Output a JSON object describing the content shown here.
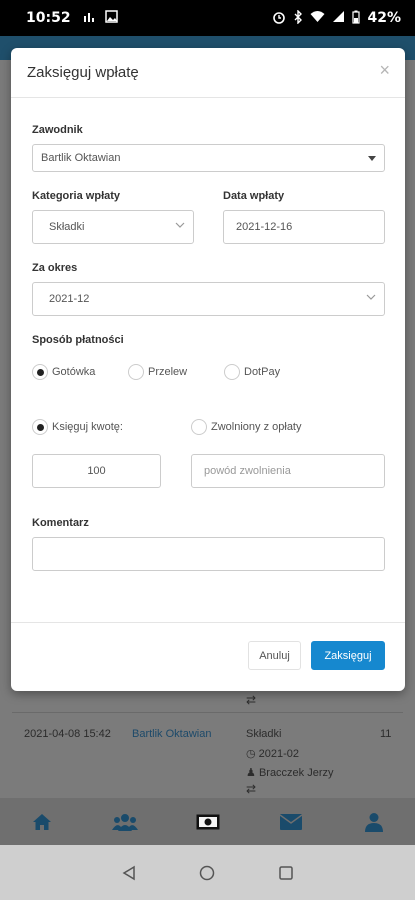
{
  "status_bar": {
    "time": "10:52",
    "battery": "42%",
    "left_icons": [
      "signal-boost-icon",
      "image-icon"
    ],
    "right_icons": [
      "alarm-icon",
      "bluetooth-icon",
      "wifi-icon",
      "cell-signal-icon",
      "battery-icon"
    ]
  },
  "modal": {
    "title": "Zaksięguj wpłatę",
    "close_glyph": "×",
    "player_label": "Zawodnik",
    "player_value": "Bartlik Oktawian",
    "category_label": "Kategoria wpłaty",
    "category_value": "Składki",
    "date_label": "Data wpłaty",
    "date_value": "2021-12-16",
    "period_label": "Za okres",
    "period_value": "2021-12",
    "method_label": "Sposób płatności",
    "methods": [
      "Gotówka",
      "Przelew",
      "DotPay"
    ],
    "method_selected": "Gotówka",
    "amount_option": "Księguj kwotę:",
    "exempt_option": "Zwolniony z opłaty",
    "amount_value": "100",
    "exempt_reason_placeholder": "powód zwolnienia",
    "comment_label": "Komentarz",
    "comment_value": "",
    "cancel_label": "Anuluj",
    "submit_label": "Zaksięguj"
  },
  "background_table": {
    "row": {
      "date": "2021-04-08 15:42",
      "player": "Bartlik Oktawian",
      "category": "Składki",
      "period": "2021-02",
      "collector": "Bracczek Jerzy",
      "number": "11"
    }
  },
  "bottom_nav": [
    "home-icon",
    "users-icon",
    "money-icon",
    "mail-icon",
    "user-icon"
  ],
  "system_nav": [
    "back-icon",
    "home-circle-icon",
    "recents-icon"
  ],
  "colors": {
    "accent": "#1688cf",
    "header": "#1f4f6b",
    "overlay": "#7b7b7b"
  }
}
